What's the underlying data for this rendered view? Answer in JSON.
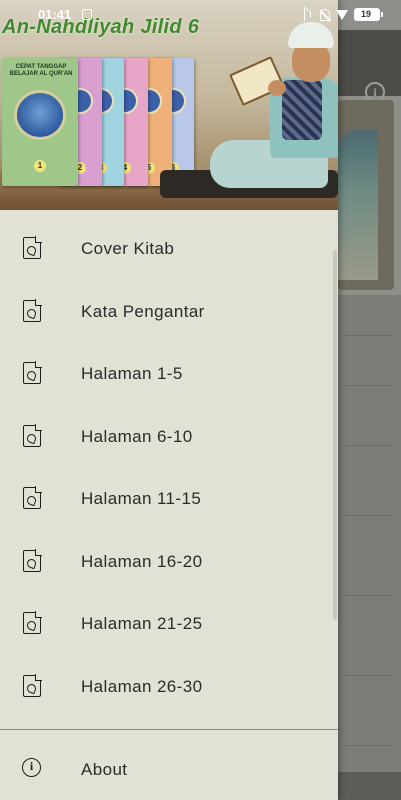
{
  "status_bar": {
    "time": "01:41",
    "battery": "19",
    "icons": [
      "sim-icon",
      "bluetooth-icon",
      "mute-icon",
      "wifi-icon",
      "battery-icon"
    ]
  },
  "drawer": {
    "header_title": "An-Nahdliyah Jilid 6",
    "book_cover_text": "CEPAT TANGGAP BELAJAR AL QUR'AN",
    "menu_items": [
      {
        "label": "Cover Kitab",
        "icon": "pdf-icon"
      },
      {
        "label": "Kata Pengantar",
        "icon": "pdf-icon"
      },
      {
        "label": "Halaman 1-5",
        "icon": "pdf-icon"
      },
      {
        "label": "Halaman 6-10",
        "icon": "pdf-icon"
      },
      {
        "label": "Halaman 11-15",
        "icon": "pdf-icon"
      },
      {
        "label": "Halaman 16-20",
        "icon": "pdf-icon"
      },
      {
        "label": "Halaman 21-25",
        "icon": "pdf-icon"
      },
      {
        "label": "Halaman 26-30",
        "icon": "pdf-icon"
      }
    ],
    "about_label": "About",
    "about_icon": "info-icon"
  },
  "colors": {
    "drawer_bg": "#e2e1d6",
    "header_title": "#3f8a2a",
    "text": "#2b2b2b"
  }
}
